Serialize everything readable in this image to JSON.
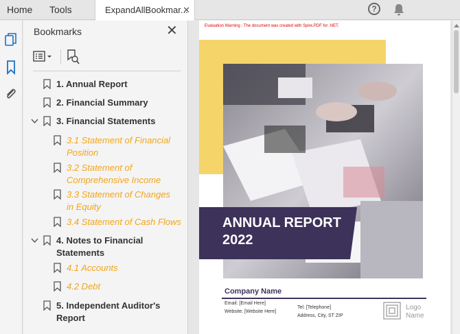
{
  "tabs": {
    "home": "Home",
    "tools": "Tools",
    "document": "ExpandAllBookmar...",
    "document_close": "✕"
  },
  "header_icons": [
    "help-icon",
    "bell-icon"
  ],
  "sidebar_icons": [
    "pages-icon",
    "bookmark-icon",
    "attachment-icon"
  ],
  "bookmarks_panel": {
    "title": "Bookmarks",
    "close": "✕",
    "toolbar_icons": [
      "options-list-icon",
      "find-bookmark-icon"
    ],
    "items": [
      {
        "label": "1. Annual Report",
        "level": 1,
        "expanded": null
      },
      {
        "label": "2. Financial Summary",
        "level": 1,
        "expanded": null
      },
      {
        "label": "3. Financial Statements",
        "level": 1,
        "expanded": true
      },
      {
        "label": "3.1 Statement of Financial Position",
        "level": 2
      },
      {
        "label": "3.2 Statement of Comprehensive Income",
        "level": 2
      },
      {
        "label": "3.3 Statement of Changes in Equity",
        "level": 2
      },
      {
        "label": "3.4 Statement of Cash Flows",
        "level": 2
      },
      {
        "label": "4. Notes to Financial Statements",
        "level": 1,
        "expanded": true
      },
      {
        "label": "4.1 Accounts",
        "level": 2
      },
      {
        "label": "4.2 Debt",
        "level": 2
      },
      {
        "label": "5. Independent Auditor's Report",
        "level": 1,
        "expanded": null
      }
    ],
    "level1_color": "#333333",
    "level2_color": "#f2a51a"
  },
  "document": {
    "warning": "Evaluation Warning : The document was created with Spire.PDF for .NET.",
    "report_title_line1": "ANNUAL REPORT",
    "report_title_line2": "2022",
    "company_name": "Company Name",
    "email": "Email: [Email Here]",
    "website": "Website: [Website Here]",
    "tel": "Tel: [Telephone]",
    "address": "Address, City, ST ZIP",
    "logo_line1": "Logo",
    "logo_line2": "Name",
    "accent_yellow": "#f5d46a",
    "accent_purple": "#3d325a"
  }
}
